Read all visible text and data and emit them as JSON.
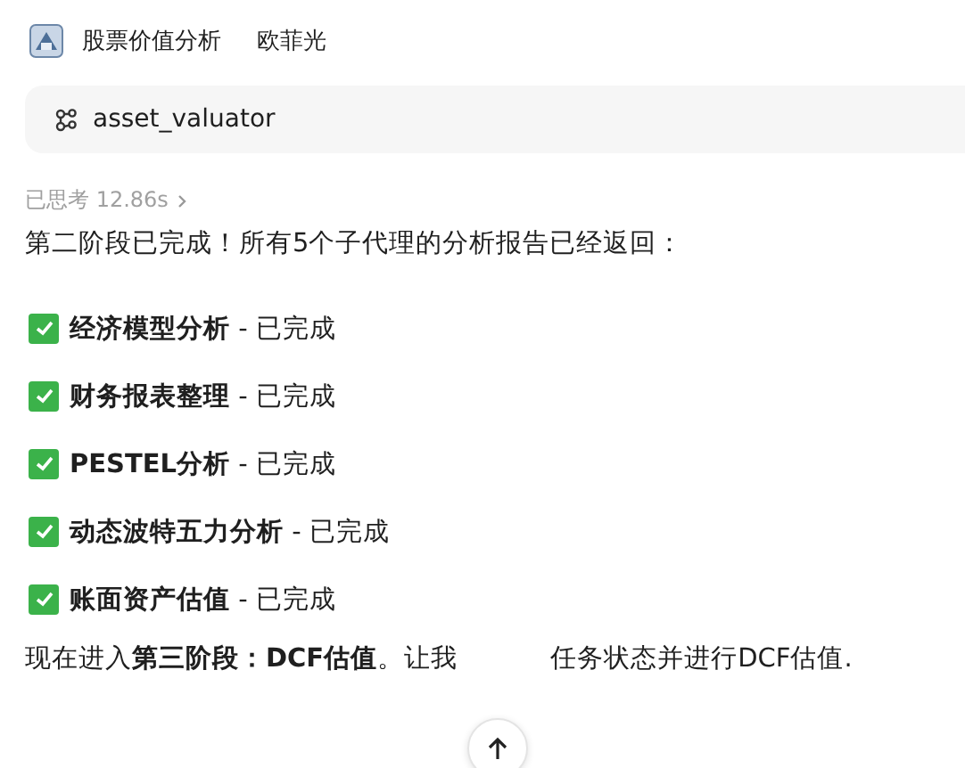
{
  "header": {
    "title": "股票价值分析",
    "subtitle": "欧菲光"
  },
  "tool_call": {
    "name": "asset_valuator"
  },
  "thinking": {
    "label": "已思考 12.86s",
    "expanded": false
  },
  "intro": "第二阶段已完成！所有5个子代理的分析报告已经返回：",
  "tasks": [
    {
      "title": "经济模型分析",
      "status": "- 已完成",
      "done": true
    },
    {
      "title": "财务报表整理",
      "status": "- 已完成",
      "done": true
    },
    {
      "title": "PESTEL分析",
      "status": "- 已完成",
      "done": true
    },
    {
      "title": "动态波特五力分析",
      "status": "- 已完成",
      "done": true
    },
    {
      "title": "账面资产估值",
      "status": "- 已完成",
      "done": true
    }
  ],
  "next_before": "现在进入**第三阶段：DCF估值**。让我",
  "next_after": "任务状态并进行DCF估值."
}
